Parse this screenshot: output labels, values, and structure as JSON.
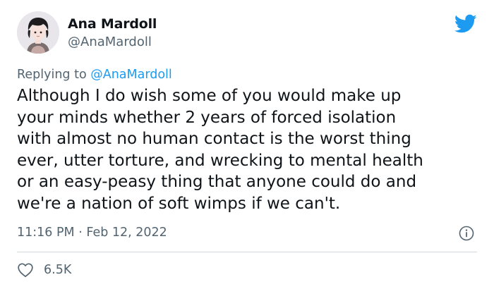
{
  "author": {
    "name": "Ana Mardoll",
    "handle": "@AnaMardoll",
    "avatar": "illustrated-avatar-dark-hair"
  },
  "reply": {
    "prefix": "Replying to ",
    "mention": "@AnaMardoll"
  },
  "tweet": {
    "lines": [
      "Although I do wish some of you would make up",
      "your minds whether 2 years of forced isolation",
      "with almost no human contact is the worst thing",
      "ever, utter torture, and wrecking to mental health",
      "or an easy-peasy thing that anyone could do and",
      "we're a nation of soft wimps if we can't."
    ]
  },
  "meta": {
    "timestamp": "11:16 PM · Feb 12, 2022"
  },
  "stats": {
    "likes": "6.5K"
  },
  "icons": {
    "brand": "twitter-bird-icon",
    "info": "info-icon",
    "like": "heart-icon"
  },
  "colors": {
    "brand": "#1d9bf0",
    "text": "#0f1419",
    "muted": "#536471",
    "divider": "#cfd9de"
  }
}
